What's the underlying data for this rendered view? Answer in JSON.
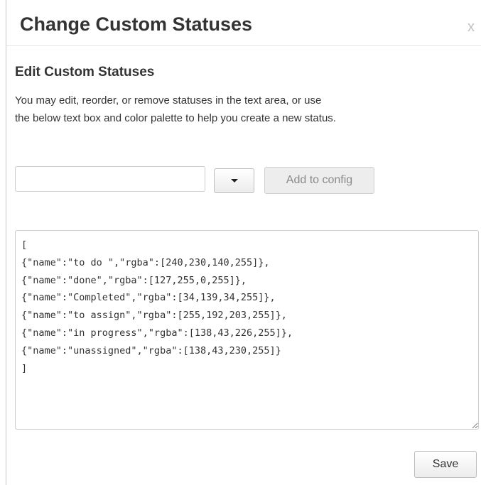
{
  "dialog": {
    "title": "Change Custom Statuses",
    "close_label": "x"
  },
  "section": {
    "title": "Edit Custom Statuses",
    "description_line1": "You may edit, reorder, or remove statuses in the text area, or use",
    "description_line2": "the below text box and color palette to help you create a new status."
  },
  "new_status": {
    "input_value": "",
    "color_dropdown_icon": "caret-down-icon",
    "add_button_label": "Add to config"
  },
  "config": {
    "text": "[\n{\"name\":\"to do \",\"rgba\":[240,230,140,255]},\n{\"name\":\"done\",\"rgba\":[127,255,0,255]},\n{\"name\":\"Completed\",\"rgba\":[34,139,34,255]},\n{\"name\":\"to assign\",\"rgba\":[255,192,203,255]},\n{\"name\":\"in progress\",\"rgba\":[138,43,226,255]},\n{\"name\":\"unassigned\",\"rgba\":[138,43,230,255]}\n]"
  },
  "footer": {
    "save_label": "Save"
  },
  "colors": {
    "title_text": "#333333",
    "close_text": "#c2c2c2",
    "disabled_button_bg": "#ededed",
    "disabled_button_text": "#8a8a8a",
    "border": "#cccccc"
  }
}
